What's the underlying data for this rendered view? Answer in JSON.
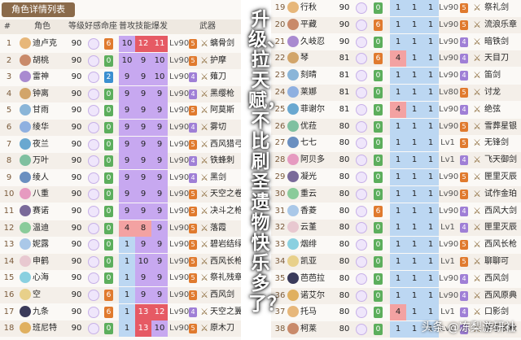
{
  "left": {
    "title": "角色详情列表",
    "headers": [
      "#",
      "角色",
      "等级",
      "好感",
      "命座",
      "普攻",
      "技能",
      "爆发",
      "武器"
    ],
    "rows": [
      {
        "n": "1",
        "name": "迪卢克",
        "lv": "90",
        "fav": "10",
        "con": "6",
        "a": "10",
        "e": "12",
        "q": "11",
        "wlv": "Lv90",
        "wr": "5",
        "weapon": "螭骨剑"
      },
      {
        "n": "2",
        "name": "胡桃",
        "lv": "90",
        "fav": "10",
        "con": "0",
        "a": "10",
        "e": "9",
        "q": "10",
        "wlv": "Lv90",
        "wr": "5",
        "weapon": "护摩"
      },
      {
        "n": "3",
        "name": "雷神",
        "lv": "90",
        "fav": "10",
        "con": "2",
        "a": "9",
        "e": "9",
        "q": "10",
        "wlv": "Lv90",
        "wr": "4",
        "weapon": "薙刀"
      },
      {
        "n": "4",
        "name": "钟离",
        "lv": "90",
        "fav": "10",
        "con": "0",
        "a": "9",
        "e": "9",
        "q": "9",
        "wlv": "Lv90",
        "wr": "4",
        "weapon": "黑缨枪"
      },
      {
        "n": "5",
        "name": "甘雨",
        "lv": "90",
        "fav": "10",
        "con": "0",
        "a": "9",
        "e": "9",
        "q": "9",
        "wlv": "Lv90",
        "wr": "5",
        "weapon": "阿莫斯"
      },
      {
        "n": "6",
        "name": "绫华",
        "lv": "90",
        "fav": "10",
        "con": "0",
        "a": "9",
        "e": "9",
        "q": "9",
        "wlv": "Lv90",
        "wr": "4",
        "weapon": "雾切"
      },
      {
        "n": "7",
        "name": "夜兰",
        "lv": "90",
        "fav": "10",
        "con": "0",
        "a": "9",
        "e": "9",
        "q": "9",
        "wlv": "Lv90",
        "wr": "5",
        "weapon": "西风猎弓"
      },
      {
        "n": "8",
        "name": "万叶",
        "lv": "90",
        "fav": "10",
        "con": "0",
        "a": "9",
        "e": "9",
        "q": "9",
        "wlv": "Lv90",
        "wr": "4",
        "weapon": "铁蜂刺"
      },
      {
        "n": "9",
        "name": "绫人",
        "lv": "90",
        "fav": "10",
        "con": "0",
        "a": "9",
        "e": "9",
        "q": "9",
        "wlv": "Lv90",
        "wr": "4",
        "weapon": "黑剑"
      },
      {
        "n": "10",
        "name": "八重",
        "lv": "90",
        "fav": "10",
        "con": "0",
        "a": "9",
        "e": "9",
        "q": "9",
        "wlv": "Lv90",
        "wr": "5",
        "weapon": "天空之卷"
      },
      {
        "n": "11",
        "name": "赛诺",
        "lv": "90",
        "fav": "4",
        "con": "0",
        "a": "9",
        "e": "9",
        "q": "9",
        "wlv": "Lv90",
        "wr": "5",
        "weapon": "决斗之枪"
      },
      {
        "n": "12",
        "name": "温迪",
        "lv": "90",
        "fav": "10",
        "con": "0",
        "a": "4",
        "e": "8",
        "q": "9",
        "wlv": "Lv90",
        "wr": "5",
        "weapon": "落霞"
      },
      {
        "n": "13",
        "name": "妮露",
        "lv": "90",
        "fav": "10",
        "con": "0",
        "a": "1",
        "e": "9",
        "q": "9",
        "wlv": "Lv90",
        "wr": "5",
        "weapon": "碧岩结绿"
      },
      {
        "n": "14",
        "name": "申鹤",
        "lv": "90",
        "fav": "10",
        "con": "0",
        "a": "1",
        "e": "10",
        "q": "9",
        "wlv": "Lv90",
        "wr": "5",
        "weapon": "西风长枪"
      },
      {
        "n": "15",
        "name": "心海",
        "lv": "90",
        "fav": "10",
        "con": "0",
        "a": "1",
        "e": "9",
        "q": "9",
        "wlv": "Lv90",
        "wr": "5",
        "weapon": "祭礼残章"
      },
      {
        "n": "16",
        "name": "空",
        "lv": "90",
        "fav": "10",
        "con": "6",
        "a": "1",
        "e": "9",
        "q": "9",
        "wlv": "Lv90",
        "wr": "5",
        "weapon": "西风剑"
      },
      {
        "n": "17",
        "name": "九条",
        "lv": "90",
        "fav": "10",
        "con": "6",
        "a": "1",
        "e": "13",
        "q": "12",
        "wlv": "Lv90",
        "wr": "4",
        "weapon": "天空之翼"
      },
      {
        "n": "18",
        "name": "班尼特",
        "lv": "90",
        "fav": "10",
        "con": "0",
        "a": "1",
        "e": "13",
        "q": "10",
        "wlv": "Lv90",
        "wr": "5",
        "weapon": "原木刀"
      }
    ]
  },
  "right": {
    "rows": [
      {
        "n": "19",
        "name": "行秋",
        "lv": "90",
        "fav": "10",
        "con": "0",
        "a": "1",
        "e": "1",
        "q": "1",
        "wlv": "Lv90",
        "wr": "5",
        "weapon": "祭礼剑"
      },
      {
        "n": "20",
        "name": "平藏",
        "lv": "90",
        "fav": "10",
        "con": "6",
        "a": "1",
        "e": "1",
        "q": "1",
        "wlv": "Lv90",
        "wr": "5",
        "weapon": "流浪乐章"
      },
      {
        "n": "21",
        "name": "久岐忍",
        "lv": "90",
        "fav": "10",
        "con": "0",
        "a": "1",
        "e": "1",
        "q": "1",
        "wlv": "Lv90",
        "wr": "4",
        "weapon": "暗铁剑"
      },
      {
        "n": "22",
        "name": "琴",
        "lv": "81",
        "fav": "10",
        "con": "6",
        "a": "4",
        "e": "1",
        "q": "1",
        "wlv": "Lv90",
        "wr": "4",
        "weapon": "天目刀"
      },
      {
        "n": "23",
        "name": "刻晴",
        "lv": "81",
        "fav": "10",
        "con": "0",
        "a": "1",
        "e": "1",
        "q": "1",
        "wlv": "Lv90",
        "wr": "4",
        "weapon": "笛剑"
      },
      {
        "n": "24",
        "name": "莱娜",
        "lv": "81",
        "fav": "10",
        "con": "0",
        "a": "1",
        "e": "1",
        "q": "1",
        "wlv": "Lv80",
        "wr": "5",
        "weapon": "讨龙"
      },
      {
        "n": "25",
        "name": "菲谢尔",
        "lv": "81",
        "fav": "10",
        "con": "0",
        "a": "4",
        "e": "1",
        "q": "1",
        "wlv": "Lv90",
        "wr": "4",
        "weapon": "绝弦"
      },
      {
        "n": "26",
        "name": "优菈",
        "lv": "80",
        "fav": "10",
        "con": "0",
        "a": "1",
        "e": "1",
        "q": "1",
        "wlv": "Lv90",
        "wr": "5",
        "weapon": "雪葬星银"
      },
      {
        "n": "27",
        "name": "七七",
        "lv": "80",
        "fav": "10",
        "con": "0",
        "a": "1",
        "e": "1",
        "q": "1",
        "wlv": "Lv1",
        "wr": "5",
        "weapon": "无锋剑"
      },
      {
        "n": "28",
        "name": "阿贝多",
        "lv": "80",
        "fav": "10",
        "con": "0",
        "a": "1",
        "e": "1",
        "q": "1",
        "wlv": "Lv1",
        "wr": "4",
        "weapon": "飞天御剑"
      },
      {
        "n": "29",
        "name": "凝光",
        "lv": "80",
        "fav": "10",
        "con": "0",
        "a": "1",
        "e": "1",
        "q": "1",
        "wlv": "Lv90",
        "wr": "5",
        "weapon": "匣里灭辰"
      },
      {
        "n": "30",
        "name": "重云",
        "lv": "80",
        "fav": "10",
        "con": "0",
        "a": "1",
        "e": "1",
        "q": "1",
        "wlv": "Lv90",
        "wr": "5",
        "weapon": "试作金珀"
      },
      {
        "n": "31",
        "name": "香菱",
        "lv": "80",
        "fav": "10",
        "con": "6",
        "a": "1",
        "e": "1",
        "q": "1",
        "wlv": "Lv90",
        "wr": "4",
        "weapon": "西风大剑"
      },
      {
        "n": "32",
        "name": "云堇",
        "lv": "80",
        "fav": "10",
        "con": "0",
        "a": "1",
        "e": "1",
        "q": "1",
        "wlv": "Lv1",
        "wr": "4",
        "weapon": "匣里灭辰"
      },
      {
        "n": "33",
        "name": "烟绯",
        "lv": "80",
        "fav": "10",
        "con": "0",
        "a": "1",
        "e": "1",
        "q": "1",
        "wlv": "Lv90",
        "wr": "5",
        "weapon": "西风长枪"
      },
      {
        "n": "34",
        "name": "凯亚",
        "lv": "80",
        "fav": "10",
        "con": "0",
        "a": "1",
        "e": "1",
        "q": "1",
        "wlv": "Lv1",
        "wr": "5",
        "weapon": "聊聊可"
      },
      {
        "n": "35",
        "name": "芭芭拉",
        "lv": "80",
        "fav": "10",
        "con": "0",
        "a": "1",
        "e": "1",
        "q": "1",
        "wlv": "Lv90",
        "wr": "4",
        "weapon": "西风剑"
      },
      {
        "n": "36",
        "name": "诺艾尔",
        "lv": "80",
        "fav": "10",
        "con": "0",
        "a": "1",
        "e": "1",
        "q": "1",
        "wlv": "Lv90",
        "wr": "4",
        "weapon": "西风原典"
      },
      {
        "n": "37",
        "name": "托马",
        "lv": "80",
        "fav": "10",
        "con": "0",
        "a": "4",
        "e": "1",
        "q": "1",
        "wlv": "Lv1",
        "wr": "4",
        "weapon": "口影剑"
      },
      {
        "n": "38",
        "name": "柯莱",
        "lv": "80",
        "fav": "10",
        "con": "0",
        "a": "1",
        "e": "1",
        "q": "1",
        "wlv": "Lv1",
        "wr": "4",
        "weapon": "新手长枪"
      }
    ]
  },
  "overlay": {
    "text": "升级、拉天赋，不比刷圣遗物快乐多了？",
    "watermark": "头条 @冻梨游研社"
  },
  "colors": {
    "gold": "#c9a15a",
    "purple": "#9f7fd6",
    "blue": "#6e9fd8",
    "orange": "#e07a2e",
    "green": "#5cae5c",
    "red": "#e05a4a"
  }
}
